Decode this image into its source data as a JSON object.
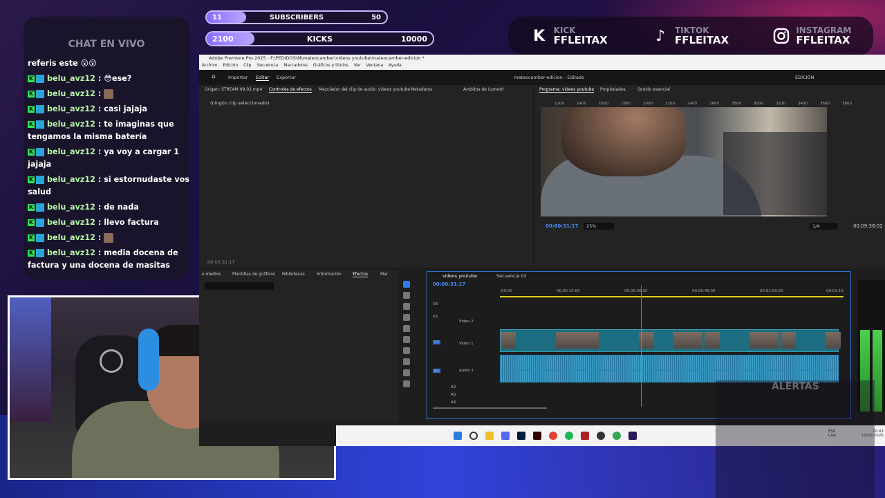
{
  "goals": {
    "subscribers": {
      "current": "11",
      "label": "SUBSCRIBERS",
      "target": "50",
      "progress": 0.22
    },
    "kicks": {
      "current": "2100",
      "label": "KICKS",
      "target": "10000",
      "progress": 0.21
    }
  },
  "socials": [
    {
      "icon": "kick-icon",
      "name": "KICK",
      "handle": "FFLEITAX"
    },
    {
      "icon": "tiktok-icon",
      "name": "TIKTOK",
      "handle": "FFLEITAX"
    },
    {
      "icon": "instagram-icon",
      "name": "INSTAGRAM",
      "handle": "FFLEITAX"
    }
  ],
  "chat": {
    "title": "CHAT EN VIVO",
    "first_line": "referis este 😲😲",
    "messages": [
      {
        "user": "belu_avz12",
        "text": ": 😳ese?"
      },
      {
        "user": "belu_avz12",
        "text": ":",
        "emote": true
      },
      {
        "user": "belu_avz12",
        "text": ": casi jajaja"
      },
      {
        "user": "belu_avz12",
        "text": ": te imaginas que tengamos la misma batería"
      },
      {
        "user": "belu_avz12",
        "text": ": ya voy a cargar 1 jajaja"
      },
      {
        "user": "belu_avz12",
        "text": ": si estornudaste vos salud"
      },
      {
        "user": "belu_avz12",
        "text": ": de nada"
      },
      {
        "user": "belu_avz12",
        "text": ": llevo factura"
      },
      {
        "user": "belu_avz12",
        "text": ":",
        "emote": true
      },
      {
        "user": "belu_avz12",
        "text": ": media docena de factura y una docena de masitas"
      }
    ]
  },
  "premiere": {
    "title": "Adobe Premiere Pro 2025 - F:\\PEDIDOS\\M\\mateocamber\\videos youtube\\mateocamber-edicion *",
    "menu": [
      "Archivo",
      "Edición",
      "Clip",
      "Secuencia",
      "Marcadores",
      "Gráficos y títulos",
      "Ver",
      "Ventana",
      "Ayuda"
    ],
    "header": {
      "importar": "Importar",
      "editar": "Editar",
      "exportar": "Exportar",
      "project": "mateocamber-edicion - Editado",
      "edicion": "EDICIÓN"
    },
    "source_tabs": [
      "Origen: STREAM 09.02.mp4",
      "Controles de efectos",
      "Mezclador del clip de audio: videos youtube",
      "Metadatos",
      "Ámbitos de Lumetri"
    ],
    "no_clip": "(ningún clip seleccionado)",
    "source_tc": "00:00:31:17",
    "program_tabs": [
      "Programa: videos youtube",
      "Propiedades",
      "Sonido esencial"
    ],
    "ruler": [
      "1200",
      "1400",
      "1600",
      "1800",
      "2000",
      "2200",
      "2400",
      "2600",
      "2800",
      "3000",
      "3200",
      "3400",
      "3600",
      "3800"
    ],
    "program_tc": "00:00:31:17",
    "zoom": "25%",
    "quality": "1/4",
    "duration": "00:09:38:02",
    "project_tabs": [
      "e medios",
      "Plantillas de gráficos",
      "Bibliotecas",
      "Información",
      "Efectos",
      "Mar"
    ],
    "timeline_tabs": [
      "videos youtube",
      "Secuencia 02"
    ],
    "timeline_tc": "00:00:31:17",
    "timeline_ruler": [
      ":00:00",
      "00:00:15:00",
      "00:00:30:00",
      "00:00:45:00",
      "00:01:00:00",
      "00:01:15:"
    ],
    "tracks": [
      "V3",
      "V2",
      "Video 2",
      "V1",
      "Video 1",
      "A1",
      "Audio 1",
      "A2",
      "A3",
      "A4"
    ],
    "clock": {
      "time": "20:43",
      "date": "15/02/2026",
      "lang": "ESP",
      "region": "LAA"
    }
  },
  "alertas": "ALERTAS"
}
